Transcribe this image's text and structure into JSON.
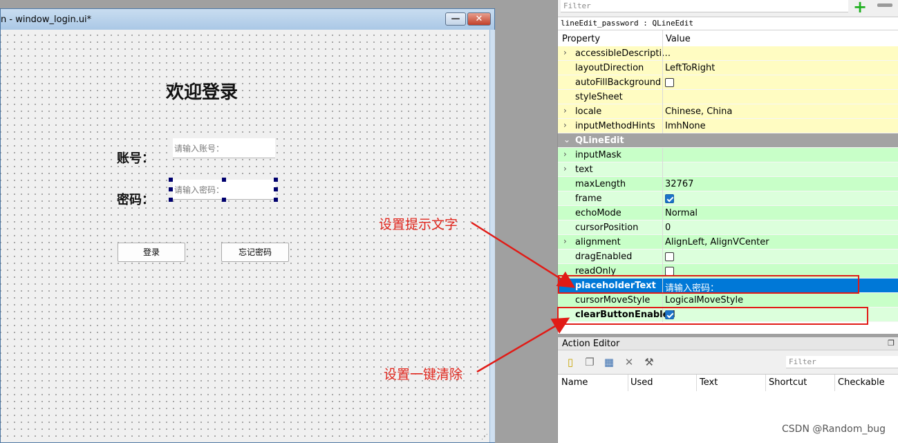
{
  "designer": {
    "title": "n - window_login.ui*",
    "min_glyph": "—",
    "close_glyph": "✕",
    "form_title": "欢迎登录",
    "account_label": "账号：",
    "account_placeholder": "请输入账号：",
    "password_label": "密码：",
    "password_placeholder": "请输入密码：",
    "login_button": "登录",
    "forgot_button": "忘记密码"
  },
  "annotations": {
    "placeholder_note": "设置提示文字",
    "clear_note": "设置一键清除",
    "color": "#e0261d"
  },
  "property_editor": {
    "filter_placeholder": "Filter",
    "object_label": "lineEdit_password : QLineEdit",
    "col_property": "Property",
    "col_value": "Value",
    "rows": [
      {
        "name": "accessibleDescripti…",
        "value": "",
        "expander": "›",
        "bg": "yellow"
      },
      {
        "name": "layoutDirection",
        "value": "LeftToRight",
        "expander": "",
        "bg": "yellow"
      },
      {
        "name": "autoFillBackground",
        "value": "",
        "checkbox": false,
        "expander": "",
        "bg": "yellow"
      },
      {
        "name": "styleSheet",
        "value": "",
        "expander": "",
        "bg": "yellow"
      },
      {
        "name": "locale",
        "value": "Chinese, China",
        "expander": "›",
        "bg": "yellow"
      },
      {
        "name": "inputMethodHints",
        "value": "ImhNone",
        "expander": "›",
        "bg": "yellow"
      },
      {
        "name": "QLineEdit",
        "value": "",
        "expander": "⌄",
        "bg": "group"
      },
      {
        "name": "inputMask",
        "value": "",
        "expander": "›",
        "bg": "green"
      },
      {
        "name": "text",
        "value": "",
        "expander": "›",
        "bg": "green-alt"
      },
      {
        "name": "maxLength",
        "value": "32767",
        "expander": "",
        "bg": "green"
      },
      {
        "name": "frame",
        "value": "",
        "checkbox": true,
        "expander": "",
        "bg": "green-alt"
      },
      {
        "name": "echoMode",
        "value": "Normal",
        "expander": "",
        "bg": "green"
      },
      {
        "name": "cursorPosition",
        "value": "0",
        "expander": "",
        "bg": "green-alt"
      },
      {
        "name": "alignment",
        "value": "AlignLeft, AlignVCenter",
        "expander": "›",
        "bg": "green"
      },
      {
        "name": "dragEnabled",
        "value": "",
        "checkbox": false,
        "expander": "",
        "bg": "green-alt"
      },
      {
        "name": "readOnly",
        "value": "",
        "checkbox": false,
        "expander": "",
        "bg": "green"
      },
      {
        "name": "placeholderText",
        "value": "请输入密码：",
        "expander": "›",
        "bg": "selected",
        "bold": true
      },
      {
        "name": "cursorMoveStyle",
        "value": "LogicalMoveStyle",
        "expander": "",
        "bg": "green"
      },
      {
        "name": "clearButtonEnabled",
        "value": "",
        "checkbox": true,
        "expander": "",
        "bg": "green-alt",
        "bold": true
      }
    ]
  },
  "action_editor": {
    "title": "Action Editor",
    "float_glyph": "❐",
    "filter_placeholder": "Filter",
    "columns": [
      "Name",
      "Used",
      "Text",
      "Shortcut",
      "Checkable"
    ]
  },
  "watermark": "CSDN @Random_bug"
}
